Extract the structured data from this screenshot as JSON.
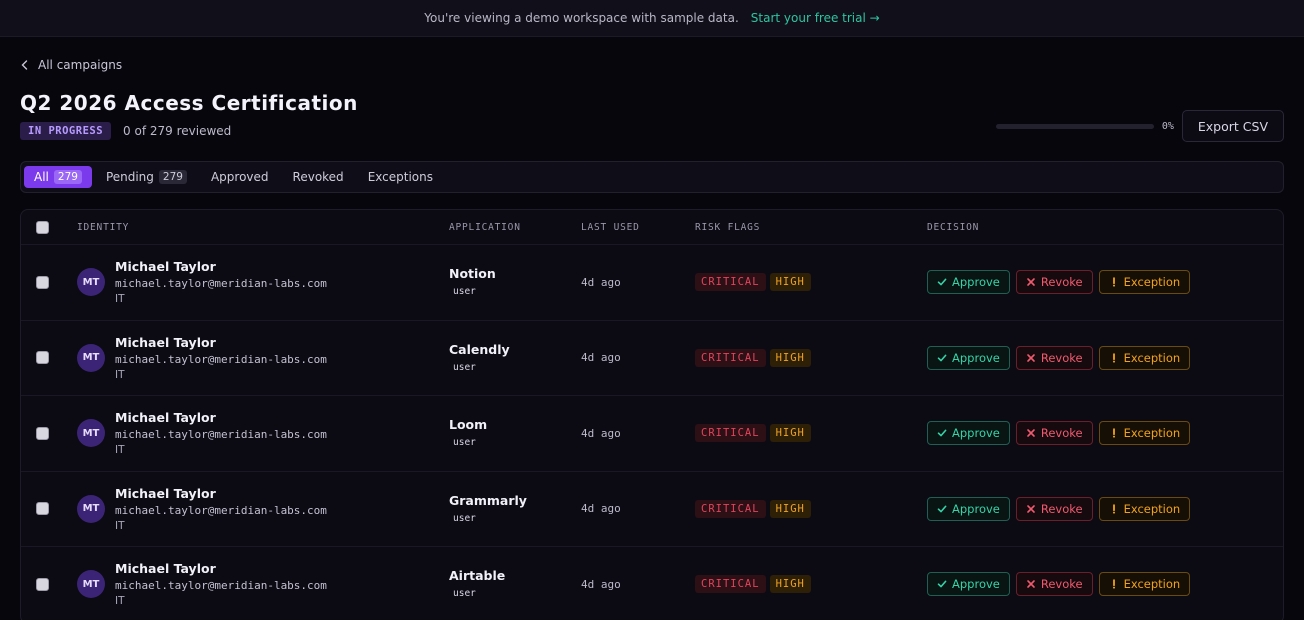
{
  "banner": {
    "text": "You're viewing a demo workspace with sample data.",
    "cta": "Start your free trial →"
  },
  "back_link": "All campaigns",
  "campaign": {
    "title": "Q2 2026 Access Certification",
    "status": "IN PROGRESS",
    "reviewed": "0 of 279 reviewed",
    "progress_label": "0%",
    "progress_value": 0,
    "export_label": "Export CSV"
  },
  "tabs": [
    {
      "label": "All",
      "count": "279"
    },
    {
      "label": "Pending",
      "count": "279"
    },
    {
      "label": "Approved",
      "count": ""
    },
    {
      "label": "Revoked",
      "count": ""
    },
    {
      "label": "Exceptions",
      "count": ""
    }
  ],
  "table": {
    "headers": [
      "IDENTITY",
      "APPLICATION",
      "LAST USED",
      "RISK FLAGS",
      "DECISION"
    ],
    "actions": {
      "approve": "Approve",
      "revoke": "Revoke",
      "exception": "Exception"
    },
    "rows": [
      {
        "initials": "MT",
        "name": "Michael Taylor",
        "email": "michael.taylor@meridian-labs.com",
        "dept": "IT",
        "app": "Notion",
        "role": "user",
        "last_used": "4d ago",
        "flags": [
          "CRITICAL",
          "HIGH"
        ]
      },
      {
        "initials": "MT",
        "name": "Michael Taylor",
        "email": "michael.taylor@meridian-labs.com",
        "dept": "IT",
        "app": "Calendly",
        "role": "user",
        "last_used": "4d ago",
        "flags": [
          "CRITICAL",
          "HIGH"
        ]
      },
      {
        "initials": "MT",
        "name": "Michael Taylor",
        "email": "michael.taylor@meridian-labs.com",
        "dept": "IT",
        "app": "Loom",
        "role": "user",
        "last_used": "4d ago",
        "flags": [
          "CRITICAL",
          "HIGH"
        ]
      },
      {
        "initials": "MT",
        "name": "Michael Taylor",
        "email": "michael.taylor@meridian-labs.com",
        "dept": "IT",
        "app": "Grammarly",
        "role": "user",
        "last_used": "4d ago",
        "flags": [
          "CRITICAL",
          "HIGH"
        ]
      },
      {
        "initials": "MT",
        "name": "Michael Taylor",
        "email": "michael.taylor@meridian-labs.com",
        "dept": "IT",
        "app": "Airtable",
        "role": "user",
        "last_used": "4d ago",
        "flags": [
          "CRITICAL",
          "HIGH"
        ]
      }
    ]
  },
  "colors": {
    "accent": "#7c3aed",
    "approve": "#36d3a8",
    "revoke": "#ef5a6f",
    "exception": "#f2a21c",
    "critical": "#e0455c",
    "high": "#f0a323"
  }
}
